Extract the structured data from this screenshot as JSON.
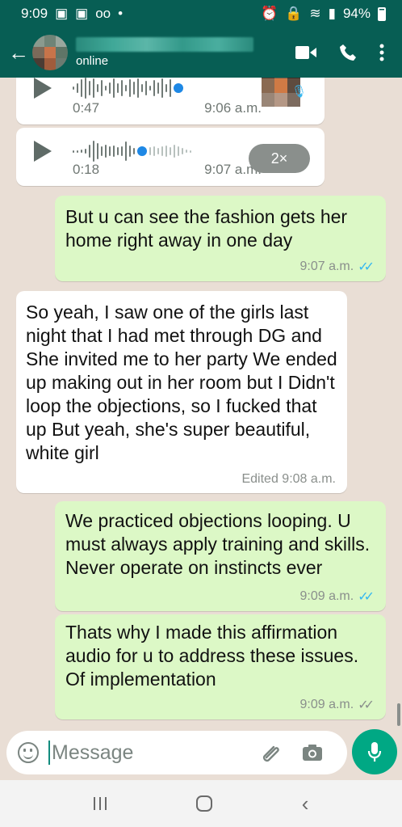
{
  "status_bar": {
    "time": "9:09",
    "battery": "94%"
  },
  "header": {
    "contact_status": "online"
  },
  "messages": [
    {
      "type": "voice",
      "duration": "0:47",
      "time": "9:06 a.m."
    },
    {
      "type": "voice",
      "duration": "0:18",
      "time": "9:07 a.m.",
      "speed": "2×"
    },
    {
      "type": "text",
      "direction": "out",
      "text": "But u can see the fashion gets her home right away in one day",
      "time": "9:07 a.m.",
      "ticks": "✓✓"
    },
    {
      "type": "text",
      "direction": "in",
      "text": "So yeah, I saw one of the girls last night that I had met through DG and She invited me to her party We ended up making out in her room but I Didn't loop the objections, so I fucked that up But yeah, she's super beautiful, white girl",
      "meta": "Edited 9:08 a.m."
    },
    {
      "type": "text",
      "direction": "out",
      "text": "We practiced objections looping. U must always apply training and skills. Never operate on instincts ever",
      "time": "9:09 a.m.",
      "ticks": "✓✓"
    },
    {
      "type": "text",
      "direction": "out",
      "text": "Thats why I made this affirmation audio for u to address these issues. Of implementation",
      "time": "9:09 a.m.",
      "ticks": "✓✓"
    }
  ],
  "input": {
    "placeholder": "Message"
  },
  "colors": {
    "header": "#075e54",
    "outgoing": "#dcf8c6",
    "incoming": "#ffffff",
    "accent": "#00a884",
    "read_ticks": "#34b7f1"
  },
  "icons": [
    "back-arrow-icon",
    "video-call-icon",
    "phone-icon",
    "more-options-icon",
    "play-icon",
    "emoji-icon",
    "attach-icon",
    "camera-icon",
    "mic-icon"
  ]
}
